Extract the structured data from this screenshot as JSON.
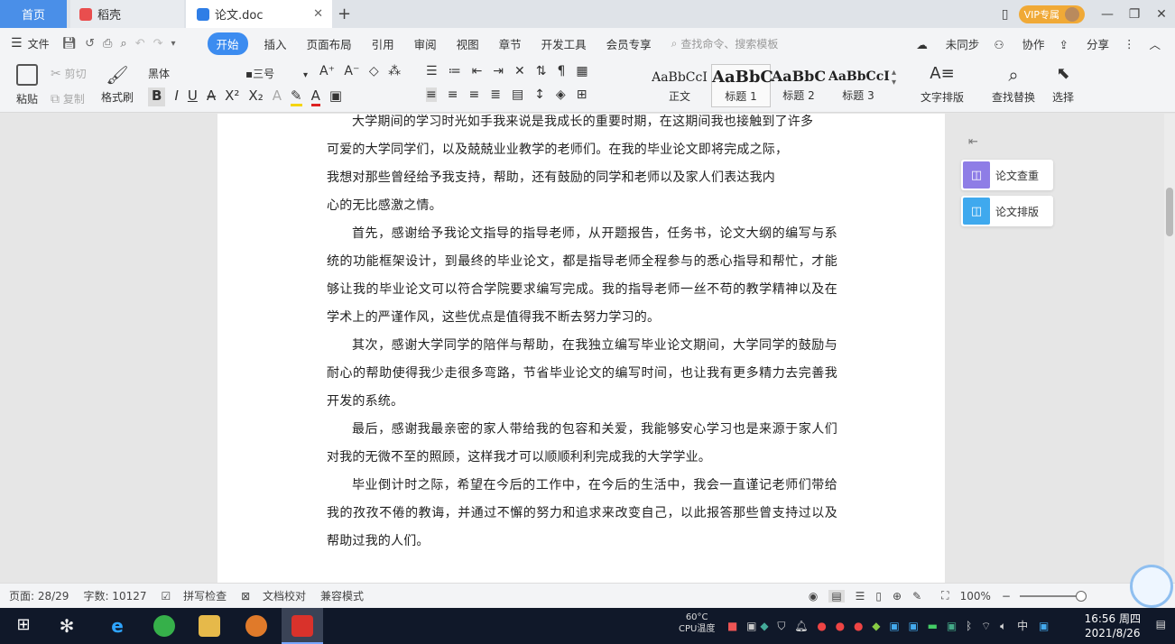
{
  "tabs": {
    "home": "首页",
    "daoke": "稻壳",
    "doc": "论文.doc",
    "new_tab": "+"
  },
  "titlebar": {
    "vip_label": "VIP专属"
  },
  "menubar": {
    "file": "文件",
    "items": [
      "开始",
      "插入",
      "页面布局",
      "引用",
      "审阅",
      "视图",
      "章节",
      "开发工具",
      "会员专享"
    ],
    "search_placeholder": "查找命令、搜索模板",
    "sync": "未同步",
    "collab": "协作",
    "share": "分享"
  },
  "ribbon": {
    "paste": "粘贴",
    "cut": "剪切",
    "copy": "复制",
    "format_painter": "格式刷",
    "font_name": "黑体",
    "font_size": "三号",
    "styles": [
      {
        "sample": "AaBbCcI",
        "name": "正文"
      },
      {
        "sample": "AaBbC",
        "name": "标题 1"
      },
      {
        "sample": "AaBbC",
        "name": "标题 2"
      },
      {
        "sample": "AaBbCcI",
        "name": "标题 3"
      }
    ],
    "text_layout": "文字排版",
    "find_replace": "查找替换",
    "select": "选择"
  },
  "side_panel": {
    "check": "论文查重",
    "layout": "论文排版"
  },
  "document": {
    "lines": [
      "大学期间的学习时光如手我来说是我成长的重要时期，在这期间我也接触到了许多",
      "可爱的大学同学们，以及兢兢业业教学的老师们。在我的毕业论文即将完成之际，",
      "我想对那些曾经给予我支持，帮助，还有鼓励的同学和老师以及家人们表达我内",
      "心的无比感激之情。"
    ],
    "paragraphs": [
      "首先，感谢给予我论文指导的指导老师，从开题报告，任务书，论文大纲的编写与系统的功能框架设计，到最终的毕业论文，都是指导老师全程参与的悉心指导和帮忙，才能够让我的毕业论文可以符合学院要求编写完成。我的指导老师一丝不苟的教学精神以及在学术上的严谨作风，这些优点是值得我不断去努力学习的。",
      "其次，感谢大学同学的陪伴与帮助，在我独立编写毕业论文期间，大学同学的鼓励与耐心的帮助使得我少走很多弯路，节省毕业论文的编写时间，也让我有更多精力去完善我开发的系统。",
      "最后，感谢我最亲密的家人带给我的包容和关爱，我能够安心学习也是来源于家人们对我的无微不至的照顾，这样我才可以顺顺利利完成我的大学学业。",
      "毕业倒计时之际，希望在今后的工作中，在今后的生活中，我会一直谨记老师们带给我的孜孜不倦的教诲，并通过不懈的努力和追求来改变自己，以此报答那些曾支持过以及帮助过我的人们。"
    ]
  },
  "statusbar": {
    "page": "页面: 28/29",
    "words": "字数: 10127",
    "spell": "拼写检查",
    "proof": "文档校对",
    "compat": "兼容模式",
    "zoom": "100%"
  },
  "taskbar": {
    "cpu_temp": "60°C",
    "cpu_label": "CPU温度",
    "ime": "中",
    "time": "16:56 周四",
    "date": "2021/8/26"
  }
}
